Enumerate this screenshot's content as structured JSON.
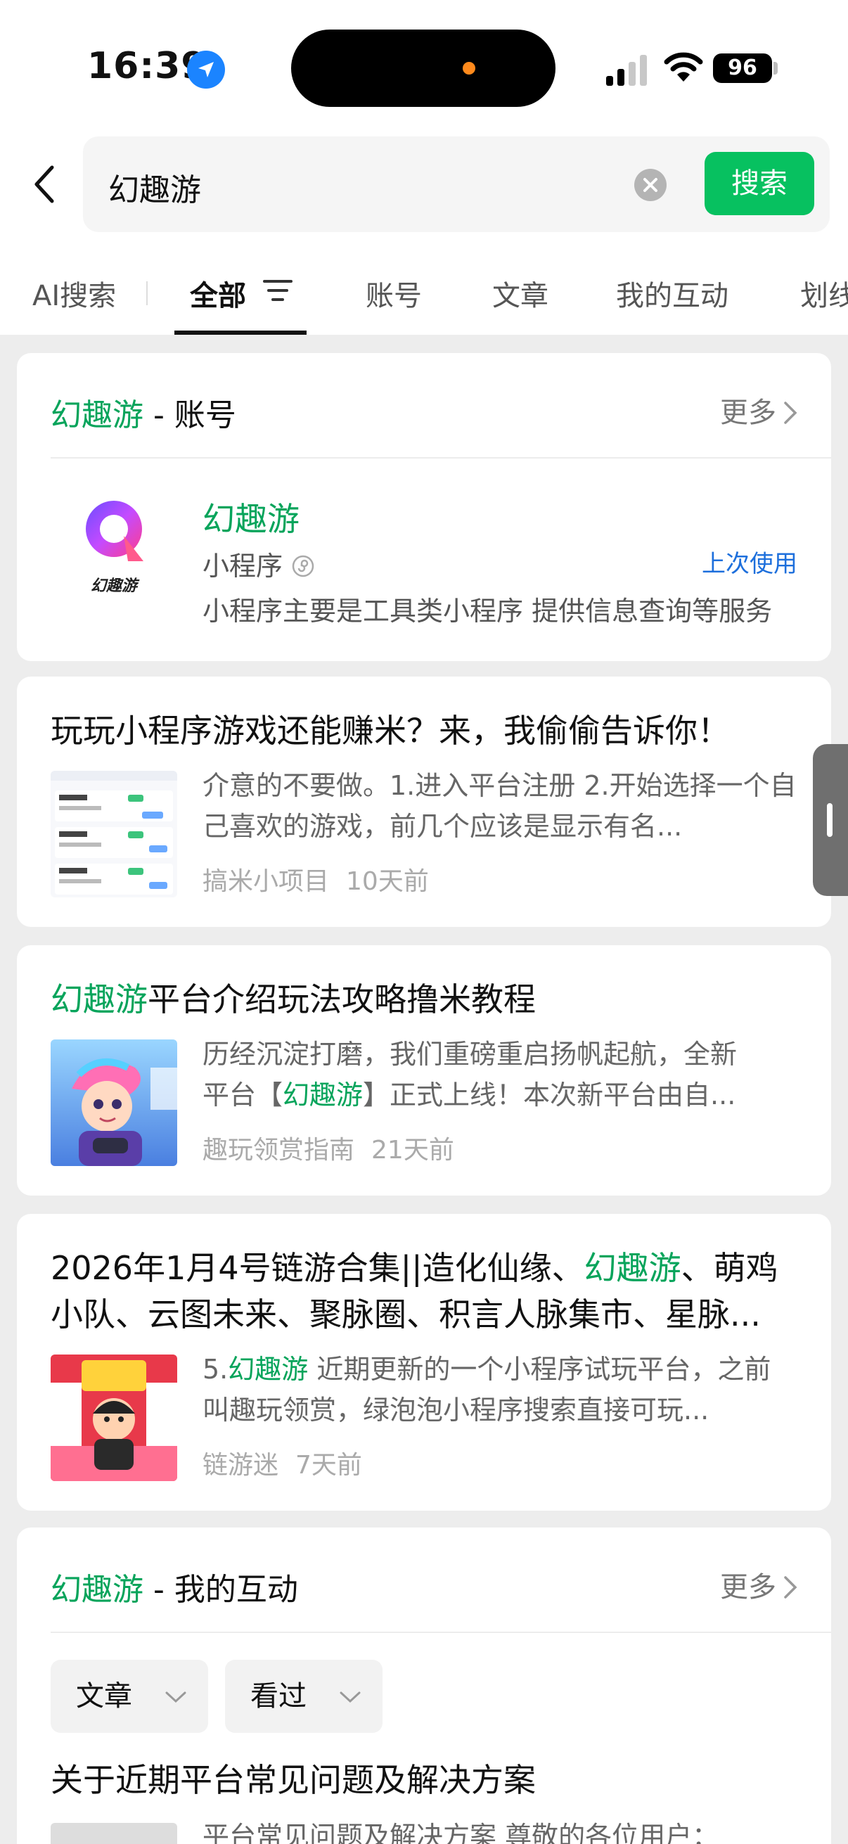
{
  "status_bar": {
    "time": "16:39",
    "battery": "96"
  },
  "search": {
    "query": "幻趣游",
    "button_label": "搜索"
  },
  "tabs": [
    {
      "label": "AI搜索"
    },
    {
      "label": "全部"
    },
    {
      "label": "账号"
    },
    {
      "label": "文章"
    },
    {
      "label": "我的互动"
    },
    {
      "label": "划线"
    }
  ],
  "account_section": {
    "keyword": "幻趣游",
    "suffix": " - 账号",
    "more": "更多",
    "logo_text": "幻趣游",
    "name": "幻趣游",
    "type": "小程序",
    "recent": "上次使用",
    "description": "小程序主要是工具类小程序 提供信息查询等服务"
  },
  "articles": [
    {
      "title": "玩玩小程序游戏还能赚米？来，我偷偷告诉你！",
      "description": "介意的不要做。1.进入平台注册 2.开始选择一个自己喜欢的游戏，前几个应该是显示有名...",
      "source": "搞米小项目",
      "time": "10天前"
    },
    {
      "title_hl": "幻趣游",
      "title_rest": "平台介绍玩法攻略撸米教程",
      "desc_line1": "历经沉淀打磨，我们重磅重启扬帆起航，全新",
      "desc_pre": "平台【",
      "desc_hl": "幻趣游",
      "desc_post": "】正式上线！本次新平台由自...",
      "source": "趣玩领赏指南",
      "time": "21天前"
    },
    {
      "title_pre": "2026年1月4号链游合集||造化仙缘、",
      "title_hl": "幻趣游",
      "title_post": "、萌鸡小队、云图未来、聚脉圈、积言人脉集市、星脉...",
      "desc_pre": "5.",
      "desc_hl": "幻趣游",
      "desc_post": " 近期更新的一个小程序试玩平台，之前叫趣玩领赏，绿泡泡小程序搜索直接可玩...",
      "source": "链游迷",
      "time": "7天前"
    }
  ],
  "interaction_section": {
    "keyword": "幻趣游",
    "suffix": " - 我的互动",
    "more": "更多",
    "chips": [
      {
        "label": "文章"
      },
      {
        "label": "看过"
      }
    ],
    "article_title": "关于近期平台常见问题及解决方案",
    "article_desc": "平台常见问题及解决方案 尊敬的各位用户："
  },
  "colors": {
    "brand_green": "#07c160",
    "highlight_green": "#07a45b",
    "link_blue": "#1d6fdc"
  }
}
